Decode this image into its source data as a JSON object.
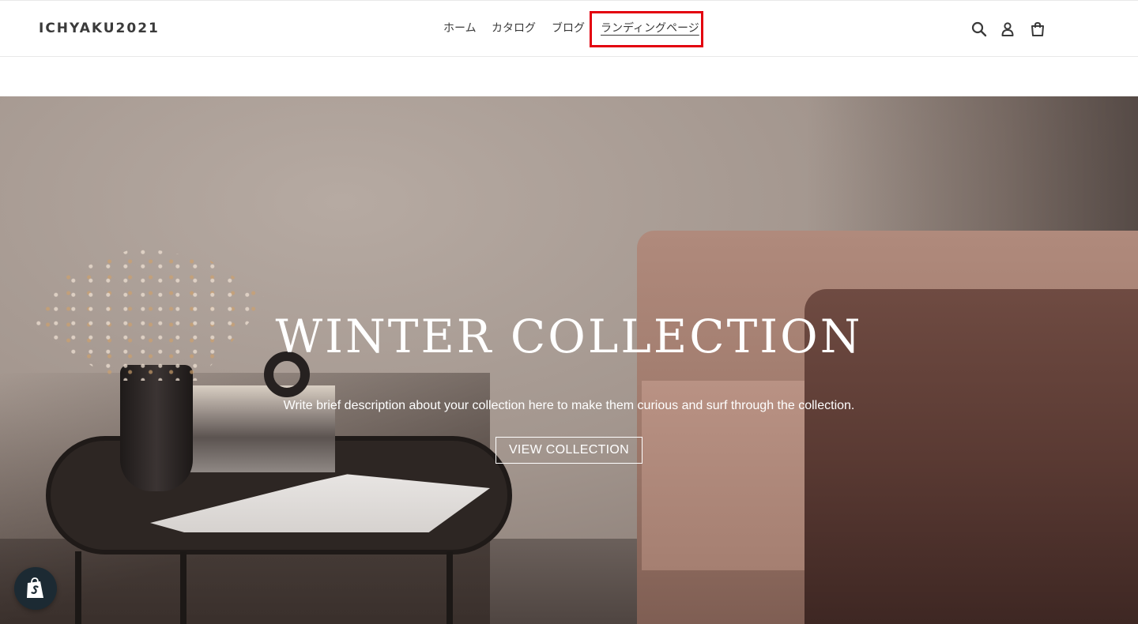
{
  "header": {
    "logo": "ICHYAKU2021",
    "nav": [
      {
        "label": "ホーム"
      },
      {
        "label": "カタログ"
      },
      {
        "label": "ブログ"
      },
      {
        "label": "ランディングページ",
        "active": true
      }
    ],
    "icons": [
      "search-icon",
      "account-icon",
      "cart-icon"
    ]
  },
  "hero": {
    "title": "WINTER COLLECTION",
    "description": "Write brief description about your collection here to make them curious and surf through the collection.",
    "button_label": "VIEW COLLECTION"
  },
  "highlight_color": "#e3000f",
  "badge": {
    "icon": "shopify-bag-icon"
  }
}
